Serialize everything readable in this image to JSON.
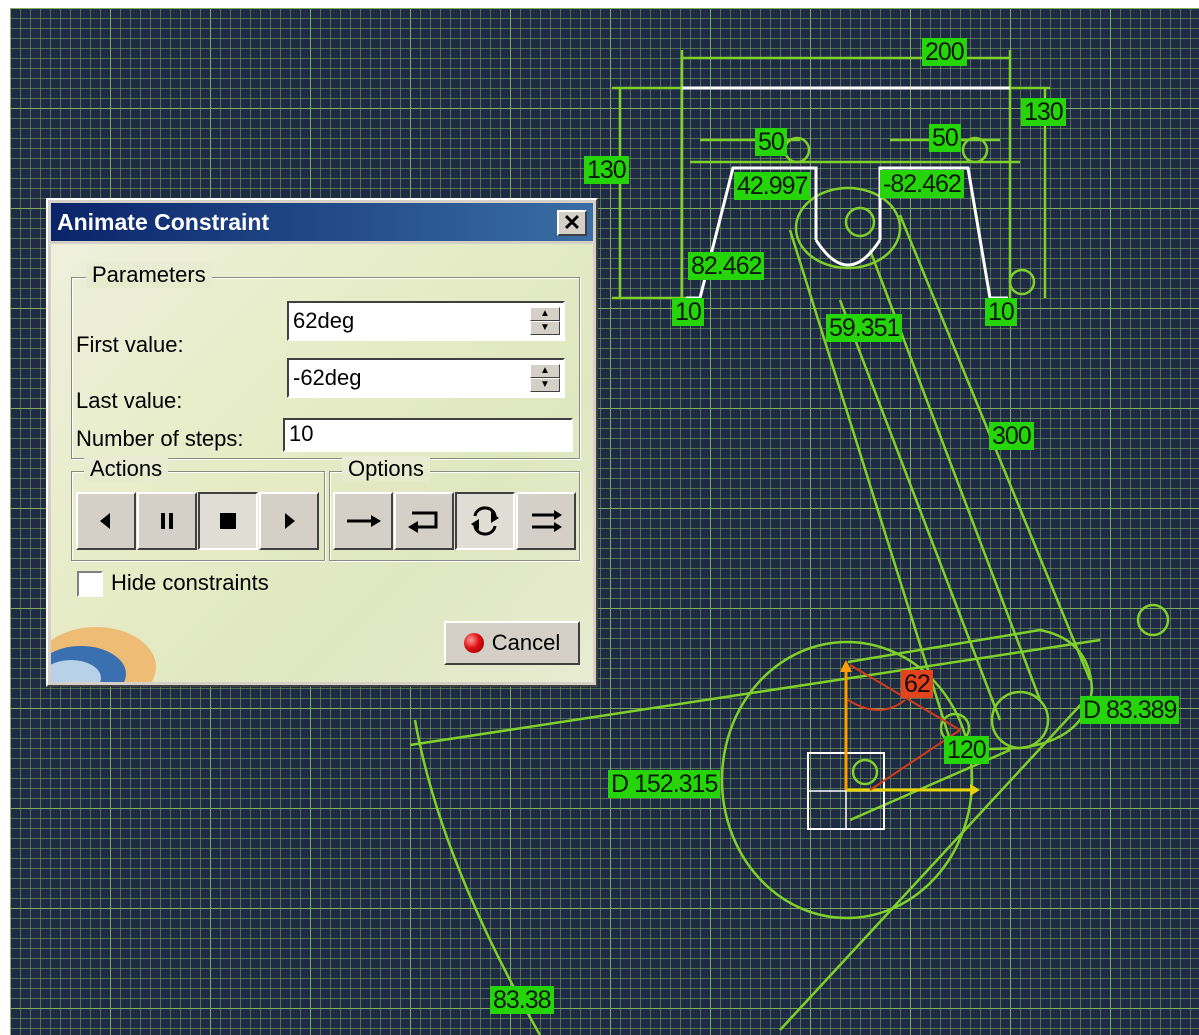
{
  "dialog": {
    "title": "Animate Constraint",
    "close_label": "✕",
    "parameters": {
      "group_label": "Parameters",
      "first_value_label": "First value:",
      "first_value": "62deg",
      "last_value_label": "Last value:",
      "last_value": "-62deg",
      "steps_label": "Number of steps:",
      "steps_value": "10"
    },
    "actions": {
      "group_label": "Actions",
      "buttons": [
        "step-backward",
        "pause",
        "stop",
        "step-forward"
      ]
    },
    "options": {
      "group_label": "Options",
      "buttons": [
        "one-shot",
        "reverse",
        "loop",
        "repeat"
      ],
      "selected": "loop"
    },
    "hide_constraints_label": "Hide constraints",
    "hide_constraints_checked": false,
    "cancel_label": "Cancel"
  },
  "sketch": {
    "dimensions": {
      "top_width": "200",
      "right_height": "130",
      "left_height": "130",
      "left_slot": "50",
      "right_slot": "50",
      "left_angle": "42.997",
      "right_angle": "-82.462",
      "left_angle2": "82.462",
      "left_foot": "10",
      "right_foot": "10",
      "arm_angle": "59.351",
      "arm_length": "300",
      "crank_angle": "62",
      "crank_length": "120",
      "small_diameter": "D 83.389",
      "large_diameter": "D 152.315",
      "bottom_arc": "83.38"
    },
    "colors": {
      "background": "#1f2a45",
      "geometry": "#7fd12a",
      "dimension_label": "#26d40a",
      "driving_label": "#e2441e",
      "profile": "#ffffff",
      "axis_h": "#e6d300",
      "axis_v": "#ff9c00"
    }
  }
}
